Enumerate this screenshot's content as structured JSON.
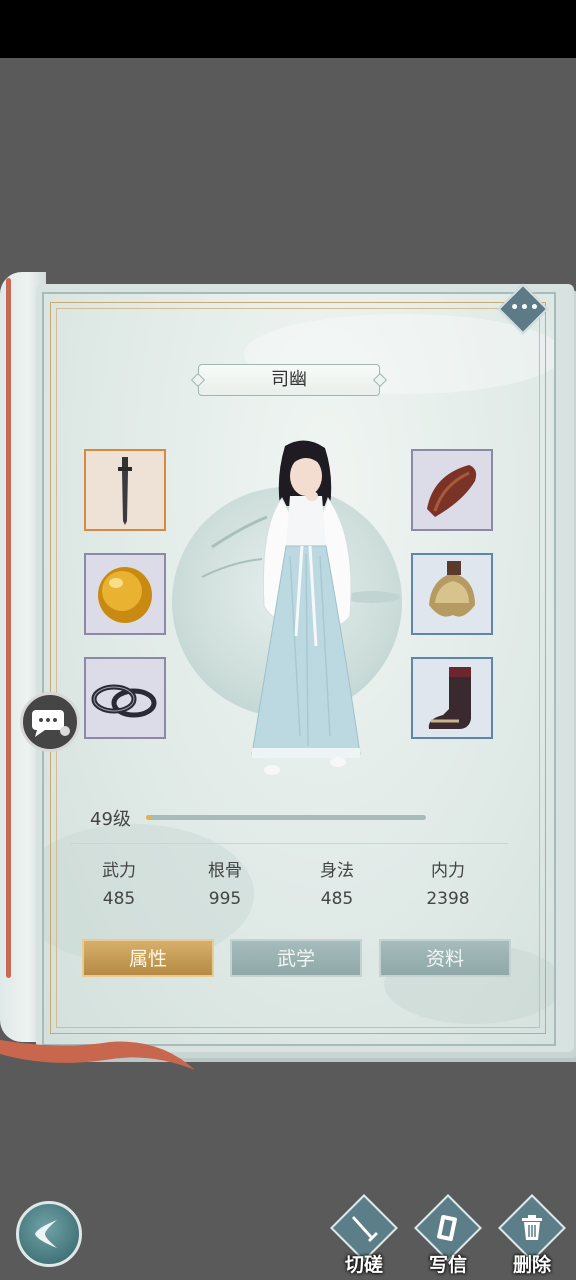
{
  "character": {
    "name": "司幽"
  },
  "level": {
    "label": "49级",
    "progress": 0.02
  },
  "stats": [
    {
      "label": "武力",
      "value": "485"
    },
    {
      "label": "根骨",
      "value": "995"
    },
    {
      "label": "身法",
      "value": "485"
    },
    {
      "label": "内力",
      "value": "2398"
    }
  ],
  "tabs": [
    {
      "label": "属性",
      "active": true
    },
    {
      "label": "武学",
      "active": false
    },
    {
      "label": "资料",
      "active": false
    }
  ],
  "equipment": {
    "left": [
      "dagger-icon",
      "amber-gem-icon",
      "bracelet-icon"
    ],
    "right": [
      "bracer-icon",
      "shoulder-armor-icon",
      "boot-icon"
    ]
  },
  "actions": [
    {
      "label": "切磋",
      "icon": "sword-icon"
    },
    {
      "label": "写信",
      "icon": "letter-icon"
    },
    {
      "label": "删除",
      "icon": "trash-icon"
    }
  ],
  "colors": {
    "active_tab": "#c49a55",
    "tab": "#9bb2b2",
    "exp_fill": "#e6b24a"
  }
}
